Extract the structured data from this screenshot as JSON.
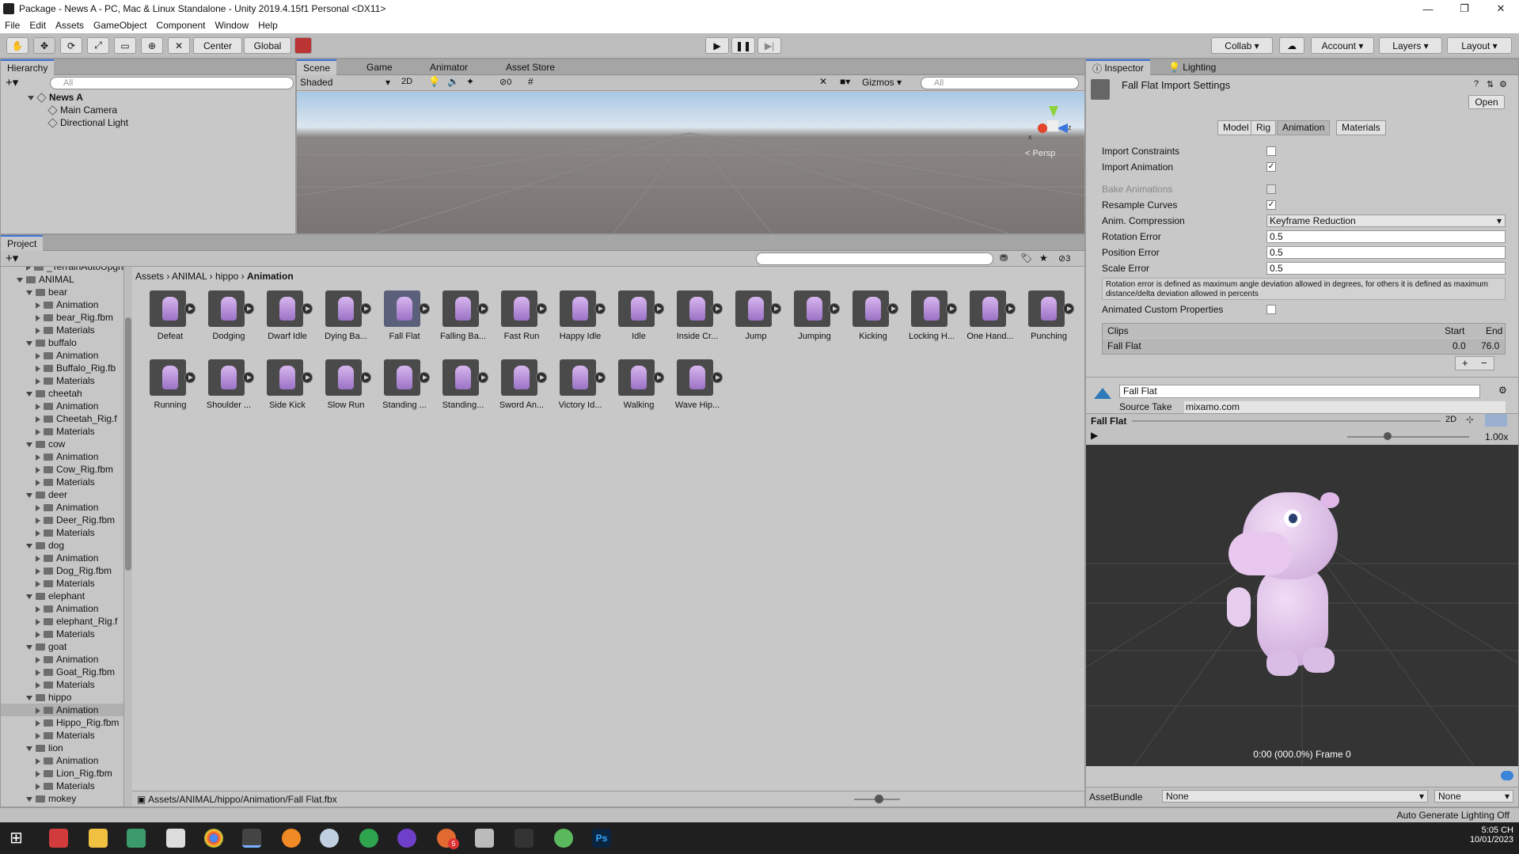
{
  "window": {
    "title": "Package - News A - PC, Mac & Linux Standalone - Unity 2019.4.15f1 Personal <DX11>"
  },
  "menu": [
    "File",
    "Edit",
    "Assets",
    "GameObject",
    "Component",
    "Window",
    "Help"
  ],
  "toolbar": {
    "center": "Center",
    "global": "Global",
    "collab": "Collab",
    "account": "Account",
    "layers": "Layers",
    "layout": "Layout"
  },
  "hierarchy": {
    "tab": "Hierarchy",
    "search_placeholder": "All",
    "scene": "News A",
    "items": [
      "Main Camera",
      "Directional Light"
    ]
  },
  "scene_view": {
    "tabs": [
      "Scene",
      "Game",
      "Animator",
      "Asset Store"
    ],
    "shading": "Shaded",
    "mode2d": "2D",
    "hidden_count": "0",
    "gizmos": "Gizmos",
    "search_placeholder": "All",
    "persp": "Persp",
    "axis_x": "x",
    "axis_z": "z"
  },
  "project": {
    "tab": "Project",
    "hidden_count": "3",
    "breadcrumb": [
      "Assets",
      "ANIMAL",
      "hippo",
      "Animation"
    ],
    "tree": [
      {
        "label": "_TerrainAutoUpgrade",
        "depth": 2,
        "kind": "folder"
      },
      {
        "label": "ANIMAL",
        "depth": 1,
        "kind": "folder",
        "open": true
      },
      {
        "label": "bear",
        "depth": 2,
        "kind": "folder",
        "open": true
      },
      {
        "label": "Animation",
        "depth": 3,
        "kind": "folder"
      },
      {
        "label": "bear_Rig.fbm",
        "depth": 3,
        "kind": "folder"
      },
      {
        "label": "Materials",
        "depth": 3,
        "kind": "folder"
      },
      {
        "label": "buffalo",
        "depth": 2,
        "kind": "folder",
        "open": true
      },
      {
        "label": "Animation",
        "depth": 3,
        "kind": "folder"
      },
      {
        "label": "Buffalo_Rig.fb",
        "depth": 3,
        "kind": "folder"
      },
      {
        "label": "Materials",
        "depth": 3,
        "kind": "folder"
      },
      {
        "label": "cheetah",
        "depth": 2,
        "kind": "folder",
        "open": true
      },
      {
        "label": "Animation",
        "depth": 3,
        "kind": "folder"
      },
      {
        "label": "Cheetah_Rig.f",
        "depth": 3,
        "kind": "folder"
      },
      {
        "label": "Materials",
        "depth": 3,
        "kind": "folder"
      },
      {
        "label": "cow",
        "depth": 2,
        "kind": "folder",
        "open": true
      },
      {
        "label": "Animation",
        "depth": 3,
        "kind": "folder"
      },
      {
        "label": "Cow_Rig.fbm",
        "depth": 3,
        "kind": "folder"
      },
      {
        "label": "Materials",
        "depth": 3,
        "kind": "folder"
      },
      {
        "label": "deer",
        "depth": 2,
        "kind": "folder",
        "open": true
      },
      {
        "label": "Animation",
        "depth": 3,
        "kind": "folder"
      },
      {
        "label": "Deer_Rig.fbm",
        "depth": 3,
        "kind": "folder"
      },
      {
        "label": "Materials",
        "depth": 3,
        "kind": "folder"
      },
      {
        "label": "dog",
        "depth": 2,
        "kind": "folder",
        "open": true
      },
      {
        "label": "Animation",
        "depth": 3,
        "kind": "folder"
      },
      {
        "label": "Dog_Rig.fbm",
        "depth": 3,
        "kind": "folder"
      },
      {
        "label": "Materials",
        "depth": 3,
        "kind": "folder"
      },
      {
        "label": "elephant",
        "depth": 2,
        "kind": "folder",
        "open": true
      },
      {
        "label": "Animation",
        "depth": 3,
        "kind": "folder"
      },
      {
        "label": "elephant_Rig.f",
        "depth": 3,
        "kind": "folder"
      },
      {
        "label": "Materials",
        "depth": 3,
        "kind": "folder"
      },
      {
        "label": "goat",
        "depth": 2,
        "kind": "folder",
        "open": true
      },
      {
        "label": "Animation",
        "depth": 3,
        "kind": "folder"
      },
      {
        "label": "Goat_Rig.fbm",
        "depth": 3,
        "kind": "folder"
      },
      {
        "label": "Materials",
        "depth": 3,
        "kind": "folder"
      },
      {
        "label": "hippo",
        "depth": 2,
        "kind": "folder",
        "open": true
      },
      {
        "label": "Animation",
        "depth": 3,
        "kind": "folder",
        "selected": true
      },
      {
        "label": "Hippo_Rig.fbm",
        "depth": 3,
        "kind": "folder"
      },
      {
        "label": "Materials",
        "depth": 3,
        "kind": "folder"
      },
      {
        "label": "lion",
        "depth": 2,
        "kind": "folder",
        "open": true
      },
      {
        "label": "Animation",
        "depth": 3,
        "kind": "folder"
      },
      {
        "label": "Lion_Rig.fbm",
        "depth": 3,
        "kind": "folder"
      },
      {
        "label": "Materials",
        "depth": 3,
        "kind": "folder"
      },
      {
        "label": "mokey",
        "depth": 2,
        "kind": "folder",
        "open": true
      }
    ],
    "assets": [
      "Defeat",
      "Dodging",
      "Dwarf Idle",
      "Dying Ba...",
      "Fall Flat",
      "Falling Ba...",
      "Fast Run",
      "Happy Idle",
      "Idle",
      "Inside Cr...",
      "Jump",
      "Jumping",
      "Kicking",
      "Locking H...",
      "One Hand...",
      "Punching",
      "Running",
      "Shoulder ...",
      "Side Kick",
      "Slow Run",
      "Standing ...",
      "Standing...",
      "Sword An...",
      "Victory Id...",
      "Walking",
      "Wave Hip..."
    ],
    "selected_asset": "Fall Flat",
    "status_path": "Assets/ANIMAL/hippo/Animation/Fall Flat.fbx"
  },
  "inspector": {
    "tabs": [
      "Inspector",
      "Lighting"
    ],
    "title": "Fall Flat Import Settings",
    "open": "Open",
    "subtabs": [
      "Model",
      "Rig",
      "Animation",
      "Materials"
    ],
    "active_subtab": "Animation",
    "import_constraints": "Import Constraints",
    "import_animation": "Import Animation",
    "bake_animations": "Bake Animations",
    "resample_curves": "Resample Curves",
    "anim_compression_label": "Anim. Compression",
    "anim_compression": "Keyframe Reduction",
    "rotation_error_label": "Rotation Error",
    "rotation_error": "0.5",
    "position_error_label": "Position Error",
    "position_error": "0.5",
    "scale_error_label": "Scale Error",
    "scale_error": "0.5",
    "help": "Rotation error is defined as maximum angle deviation allowed in degrees, for others it is defined as maximum distance/delta deviation allowed in percents",
    "animated_custom_properties": "Animated Custom Properties",
    "clips_header": "Clips",
    "start_header": "Start",
    "end_header": "End",
    "clip": {
      "name": "Fall Flat",
      "start": "0.0",
      "end": "76.0"
    },
    "plus": "+",
    "minus": "−",
    "clip_name_field": "Fall Flat",
    "source_take_label": "Source Take",
    "source_take": "mixamo.com",
    "preview_title": "Fall Flat",
    "preview_2d": "2D",
    "speed": "1.00x",
    "timecode": "0:00 (000.0%) Frame 0",
    "assetbundle_label": "AssetBundle",
    "assetbundle": "None",
    "variant": "None",
    "auto_lighting": "Auto Generate Lighting Off"
  },
  "taskbar": {
    "time": "5:05 CH",
    "date": "10/01/2023",
    "badge": "5"
  }
}
